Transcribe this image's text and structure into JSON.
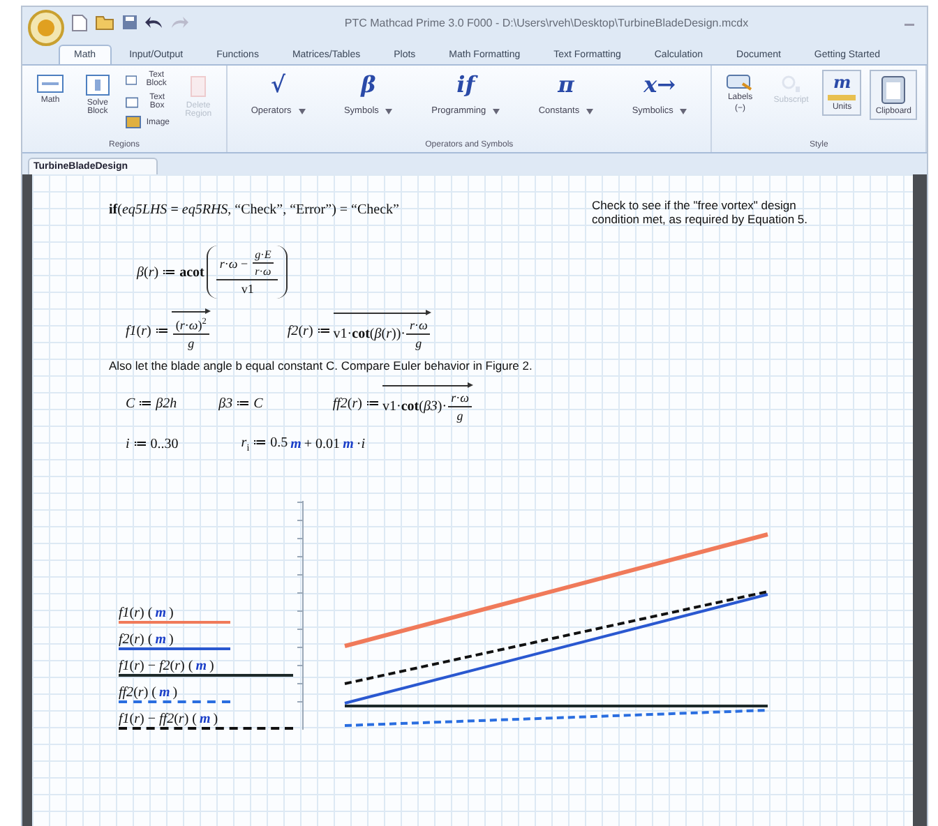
{
  "window": {
    "title": "PTC Mathcad Prime 3.0 F000 - D:\\Users\\rveh\\Desktop\\TurbineBladeDesign.mcdx"
  },
  "tabs": [
    {
      "label": "Math",
      "selected": true
    },
    {
      "label": "Input/Output",
      "selected": false
    },
    {
      "label": "Functions",
      "selected": false
    },
    {
      "label": "Matrices/Tables",
      "selected": false
    },
    {
      "label": "Plots",
      "selected": false
    },
    {
      "label": "Math Formatting",
      "selected": false
    },
    {
      "label": "Text Formatting",
      "selected": false
    },
    {
      "label": "Calculation",
      "selected": false
    },
    {
      "label": "Document",
      "selected": false
    },
    {
      "label": "Getting Started",
      "selected": false
    }
  ],
  "ribbon": {
    "regions": {
      "label": "Regions",
      "math": "Math",
      "solve": "Solve Block",
      "small": [
        "Text Block",
        "Text Box",
        "Image"
      ],
      "delete": {
        "label": "Delete Region",
        "disabled": true
      }
    },
    "operators": {
      "label": "Operators and Symbols",
      "items": [
        {
          "glyph": "√",
          "label": "Operators"
        },
        {
          "glyph": "β",
          "label": "Symbols"
        },
        {
          "glyph": "if",
          "label": "Programming"
        },
        {
          "glyph": "π",
          "label": "Constants"
        },
        {
          "glyph": "x→",
          "label": "Symbolics"
        }
      ]
    },
    "style": {
      "label": "Style",
      "labels": {
        "label": "Labels",
        "value": "(−)"
      },
      "subscript": {
        "label": "Subscript",
        "disabled": true
      },
      "units": {
        "glyph": "m",
        "label": "Units"
      },
      "clipboard": {
        "label": "Clipboard"
      }
    }
  },
  "document_tab": "TurbineBladeDesign",
  "sheet": {
    "check": [
      {
        "kind": "text",
        "text": "**if**(*eq5LHS* **=** *eq5RHS*, “Check”, “Error”) = “Check”"
      }
    ],
    "note": "Check to see if the \"free vortex\" design condition met, as required by Equation 5.",
    "beta": [
      {
        "kind": "text",
        "text": "*β*(*r*) ≔ **acot**"
      },
      {
        "kind": "paren",
        "body": [
          {
            "kind": "frac",
            "num": [
              {
                "kind": "text",
                "text": "*r*·*ω* −"
              },
              {
                "kind": "frac",
                "num": [
                  {
                    "kind": "text",
                    "text": "*g*·*E*"
                  }
                ],
                "den": [
                  {
                    "kind": "text",
                    "text": "*r*·*ω*"
                  }
                ]
              }
            ],
            "den": [
              {
                "kind": "text",
                "text": "v1"
              }
            ]
          }
        ]
      }
    ],
    "f1": [
      {
        "kind": "text",
        "text": "*f1*(*r*) ≔"
      },
      {
        "kind": "vec",
        "body": [
          {
            "kind": "frac",
            "num": [
              {
                "kind": "text",
                "text": "(*r*·*ω*)$^{2}$"
              }
            ],
            "den": [
              {
                "kind": "text",
                "text": "*g*"
              }
            ]
          }
        ]
      }
    ],
    "f2": [
      {
        "kind": "text",
        "text": "*f2*(*r*) ≔"
      },
      {
        "kind": "vec",
        "body": [
          {
            "kind": "text",
            "text": "v1·**cot**(*β*(*r*))·"
          },
          {
            "kind": "frac",
            "num": [
              {
                "kind": "text",
                "text": "*r*·*ω*"
              }
            ],
            "den": [
              {
                "kind": "text",
                "text": "*g*"
              }
            ]
          }
        ]
      }
    ],
    "text": "Also let the blade angle b equal constant C.  Compare Euler behavior in Figure 2.",
    "c_def": [
      {
        "kind": "text",
        "text": "*C* ≔ *β2h*"
      }
    ],
    "b3_def": [
      {
        "kind": "text",
        "text": "*β3* ≔ *C*"
      }
    ],
    "ff2": [
      {
        "kind": "text",
        "text": "*ff2*(*r*) ≔"
      },
      {
        "kind": "vec",
        "body": [
          {
            "kind": "text",
            "text": "v1·**cot**(*β3*)·"
          },
          {
            "kind": "frac",
            "num": [
              {
                "kind": "text",
                "text": "*r*·*ω*"
              }
            ],
            "den": [
              {
                "kind": "text",
                "text": "*g*"
              }
            ]
          }
        ]
      }
    ],
    "i_def": [
      {
        "kind": "text",
        "text": "*i* ≔ 0..30"
      }
    ],
    "r_def": [
      {
        "kind": "text",
        "text": "*r*$_{i}$ ≔ 0.5 "
      },
      {
        "kind": "unit",
        "text": "m"
      },
      {
        "kind": "text",
        "text": " + 0.01 "
      },
      {
        "kind": "unit",
        "text": "m"
      },
      {
        "kind": "text",
        "text": "·*i*"
      }
    ]
  },
  "plot": {
    "series": [
      {
        "color": "#f07a5a",
        "dashed": false,
        "label": [
          {
            "kind": "text",
            "text": "*f1*(*r*) ("
          },
          {
            "kind": "unit",
            "text": "m"
          },
          {
            "kind": "text",
            "text": ")"
          }
        ]
      },
      {
        "color": "#2a58d0",
        "dashed": false,
        "label": [
          {
            "kind": "text",
            "text": "*f2*(*r*) ("
          },
          {
            "kind": "unit",
            "text": "m"
          },
          {
            "kind": "text",
            "text": ")"
          }
        ]
      },
      {
        "color": "#1e2a2a",
        "dashed": false,
        "label": [
          {
            "kind": "text",
            "text": "*f1*(*r*) − *f2*(*r*) ("
          },
          {
            "kind": "unit",
            "text": "m"
          },
          {
            "kind": "text",
            "text": ")"
          }
        ]
      },
      {
        "color": "#2a6ee0",
        "dashed": true,
        "label": [
          {
            "kind": "text",
            "text": "*ff2*(*r*) ("
          },
          {
            "kind": "unit",
            "text": "m"
          },
          {
            "kind": "text",
            "text": ")"
          }
        ]
      },
      {
        "color": "#111111",
        "dashed": true,
        "label": [
          {
            "kind": "text",
            "text": "*f1*(*r*) − *ff2*(*r*) ("
          },
          {
            "kind": "unit",
            "text": "m"
          },
          {
            "kind": "text",
            "text": ")"
          }
        ]
      }
    ]
  }
}
